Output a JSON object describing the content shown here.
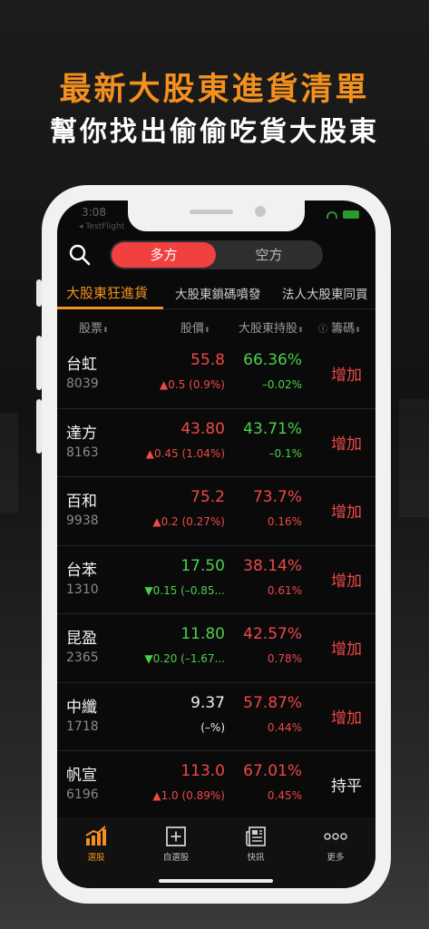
{
  "promo": {
    "headline": "最新大股東進貨清單",
    "subline": "幫你找出偷偷吃貨大股東"
  },
  "status_bar": {
    "time": "3:08",
    "back_app": "◂ TestFlight"
  },
  "segment": {
    "long": "多方",
    "short": "空方"
  },
  "subtabs": [
    "大股東狂進貨",
    "大股東鎖碼噴發",
    "法人大股東同買"
  ],
  "columns": {
    "stock": "股票",
    "price": "股價",
    "holding": "大股東持股",
    "chips": "籌碼",
    "info_icon": "ⓘ",
    "sort_icon": "⬍"
  },
  "rows": [
    {
      "name": "台虹",
      "code": "8039",
      "price": "55.8",
      "change": "▲0.5 (0.9%)",
      "holding": "66.36%",
      "holding_change": "–0.02%",
      "action": "增加"
    },
    {
      "name": "達方",
      "code": "8163",
      "price": "43.80",
      "change": "▲0.45 (1.04%)",
      "holding": "43.71%",
      "holding_change": "–0.1%",
      "action": "增加"
    },
    {
      "name": "百和",
      "code": "9938",
      "price": "75.2",
      "change": "▲0.2 (0.27%)",
      "holding": "73.7%",
      "holding_change": "0.16%",
      "action": "增加"
    },
    {
      "name": "台苯",
      "code": "1310",
      "price": "17.50",
      "change": "▼0.15 (–0.85...",
      "holding": "38.14%",
      "holding_change": "0.61%",
      "action": "增加"
    },
    {
      "name": "昆盈",
      "code": "2365",
      "price": "11.80",
      "change": "▼0.20 (–1.67...",
      "holding": "42.57%",
      "holding_change": "0.78%",
      "action": "增加"
    },
    {
      "name": "中纖",
      "code": "1718",
      "price": "9.37",
      "change": "(–%)",
      "holding": "57.87%",
      "holding_change": "0.44%",
      "action": "增加"
    },
    {
      "name": "帆宣",
      "code": "6196",
      "price": "113.0",
      "change": "▲1.0 (0.89%)",
      "holding": "67.01%",
      "holding_change": "0.45%",
      "action": "持平"
    }
  ],
  "bottom_nav": [
    {
      "label": "選股",
      "icon": "bar-chart-icon"
    },
    {
      "label": "自選股",
      "icon": "add-box-icon"
    },
    {
      "label": "快訊",
      "icon": "news-icon"
    },
    {
      "label": "更多",
      "icon": "more-dots-icon"
    }
  ],
  "colors": {
    "accent": "#f3901f",
    "up": "#f04848",
    "down": "#4cd04c",
    "segment_active": "#f04040"
  }
}
